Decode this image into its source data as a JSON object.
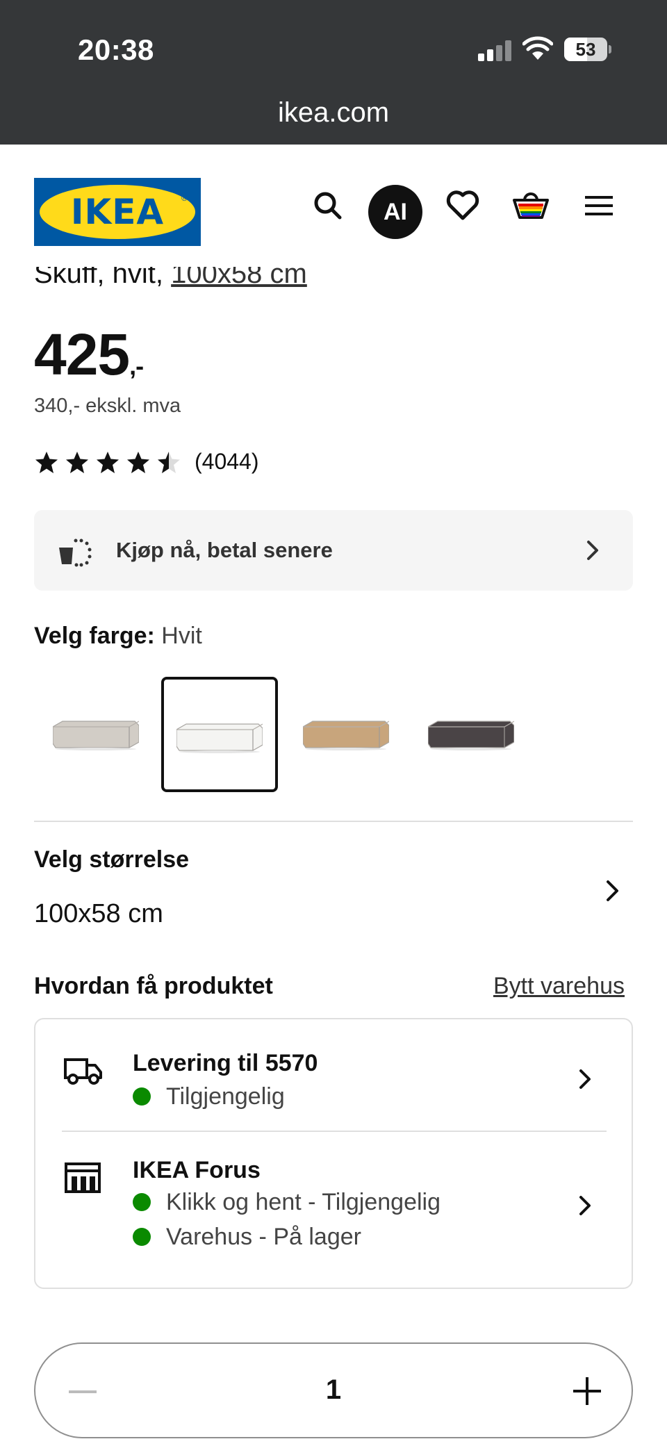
{
  "status_bar": {
    "time": "20:38",
    "battery": "53",
    "battery_level": 0.53
  },
  "browser": {
    "url": "ikea.com"
  },
  "header": {
    "logo_text": "IKEA",
    "ai_label": "AI",
    "icons": [
      "search-icon",
      "heart-icon",
      "basket-icon",
      "menu-icon"
    ]
  },
  "product": {
    "subtitle_text": "Skuff, hvit, ",
    "subtitle_link": "100x58 cm",
    "price_main": "425",
    "price_suffix": ",-",
    "price_ex_vat": "340,- ekskl. mva",
    "rating": 4.5,
    "rating_max": 5,
    "review_count": "(4044)"
  },
  "bnpl": {
    "label": "Kjøp nå, betal senere"
  },
  "color": {
    "label": "Velg farge:",
    "selected": "Hvit",
    "swatches": [
      {
        "color": "#d2cdc6",
        "selected": false
      },
      {
        "color": "#f4f4f2",
        "selected": true
      },
      {
        "color": "#c8a57c",
        "selected": false
      },
      {
        "color": "#4a4446",
        "selected": false
      }
    ]
  },
  "size": {
    "label": "Velg størrelse",
    "value": "100x58 cm"
  },
  "fulfilment": {
    "label": "Hvordan få produktet",
    "change_store": "Bytt varehus",
    "delivery": {
      "title": "Levering til 5570",
      "status": "Tilgjengelig"
    },
    "store": {
      "title": "IKEA Forus",
      "status_1": "Klikk og hent - Tilgjengelig",
      "status_2": "Varehus - På lager"
    },
    "status_color": "#0a8a00"
  },
  "quantity": {
    "value": "1"
  }
}
